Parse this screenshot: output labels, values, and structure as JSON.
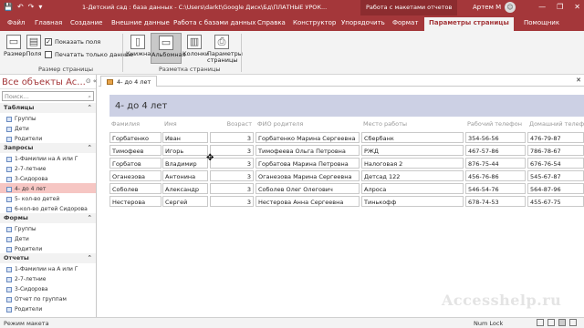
{
  "titlebar": {
    "qat": [
      "💾",
      "↶",
      "↷",
      "▾"
    ],
    "document": "1-Детский сад : база данных - C:\\Users\\darkt\\Google Диск\\Бд\\ПЛАТНЫЕ УРОК...",
    "context_title": "Работа с макетами отчетов",
    "user": "Артем М",
    "avatar": "☺",
    "window_buttons": [
      "—",
      "❐",
      "✕"
    ]
  },
  "tabs": [
    {
      "label": "Файл"
    },
    {
      "label": "Главная"
    },
    {
      "label": "Создание"
    },
    {
      "label": "Внешние данные"
    },
    {
      "label": "Работа с базами данных"
    },
    {
      "label": "Справка"
    },
    {
      "label": "Конструктор"
    },
    {
      "label": "Упорядочить"
    },
    {
      "label": "Формат"
    },
    {
      "label": "Параметры страницы"
    }
  ],
  "help_label": "Помощник",
  "ribbon": {
    "size_label": "Размер",
    "margins_label": "Поля",
    "show_margins_label": "Показать поля",
    "print_data_only_label": "Печатать только данные",
    "page_size_group": "Размер страницы",
    "portrait_label": "Книжная",
    "landscape_label": "Альбомная",
    "columns_label": "Колонки",
    "page_setup_label": "Параметры страницы",
    "page_layout_group": "Разметка страницы",
    "show_margins_checked": true,
    "print_data_only_checked": false
  },
  "nav": {
    "title": "Все объекты Ac...",
    "search_placeholder": "Поиск...",
    "sections": [
      {
        "label": "Таблицы",
        "items": [
          "Группы",
          "Дети",
          "Родители"
        ]
      },
      {
        "label": "Запросы",
        "items": [
          "1-Фамилии на А или Г",
          "2-7-летние",
          "3-Сидорова",
          "4- до 4 лет",
          "5- кол-во детей",
          "6-кол-во детей Сидорова"
        ]
      },
      {
        "label": "Формы",
        "items": [
          "Группы",
          "Дети",
          "Родители"
        ]
      },
      {
        "label": "Отчеты",
        "items": [
          "1-Фамилии на А или Г",
          "2-7-летние",
          "3-Сидорова",
          "Отчет по группам",
          "Родители"
        ]
      }
    ],
    "selected": "4- до 4 лет"
  },
  "document_tab": "4- до 4 лет",
  "report": {
    "title": "4- до 4 лет",
    "columns": [
      "Фамилия",
      "Имя",
      "Возраст",
      "ФИО родителя",
      "Место работы",
      "Рабочий телефон",
      "Домашний телефон"
    ],
    "rows": [
      [
        "Горбатенко",
        "Иван",
        "3",
        "Горбатенко Марина Сергеевна",
        "Сбербанк",
        "354-56-56",
        "476-79-87"
      ],
      [
        "Тимофеев",
        "Игорь",
        "3",
        "Тимофеева Ольга Петровна",
        "РЖД",
        "467-57-86",
        "786-78-67"
      ],
      [
        "Горбатов",
        "Владимир",
        "3",
        "Горбатова Марина Петровна",
        "Налоговая 2",
        "876-75-44",
        "676-76-54"
      ],
      [
        "Оганезова",
        "Антонина",
        "3",
        "Оганезова Марина Сергеевна",
        "Детсад 122",
        "456-76-86",
        "545-67-87"
      ],
      [
        "Соболев",
        "Александр",
        "3",
        "Соболев Олег Олегович",
        "Алроса",
        "546-54-76",
        "564-87-96"
      ],
      [
        "Нестерова",
        "Сергей",
        "3",
        "Нестерова Анна Сергеевна",
        "Тинькофф",
        "678-74-53",
        "455-67-75"
      ]
    ]
  },
  "watermark": "Accesshelp.ru",
  "status": {
    "left": "Режим макета",
    "numlock": "Num Lock"
  }
}
